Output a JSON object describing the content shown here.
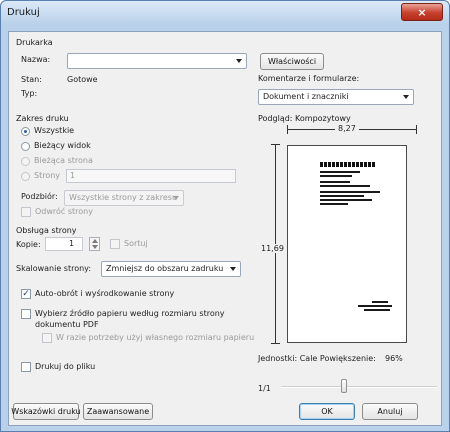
{
  "window": {
    "title": "Drukuj",
    "close_symbol": "×"
  },
  "printer": {
    "section_title": "Drukarka",
    "name_label": "Nazwa:",
    "name_value": "",
    "status_label": "Stan:",
    "status_value": "Gotowe",
    "type_label": "Typ:",
    "type_value": "",
    "properties_button": "Właściwości",
    "comments_label": "Komentarze i formularze:",
    "comments_value": "Dokument i znaczniki"
  },
  "print_range": {
    "section_title": "Zakres druku",
    "options": [
      {
        "label": "Wszystkie",
        "checked": true,
        "disabled": false
      },
      {
        "label": "Bieżący widok",
        "checked": false,
        "disabled": false
      },
      {
        "label": "Bieżąca strona",
        "checked": false,
        "disabled": true
      },
      {
        "label": "Strony",
        "checked": false,
        "disabled": true
      }
    ],
    "pages_value": "1",
    "subset_label": "Podzbiór:",
    "subset_value": "Wszystkie strony z zakresu",
    "reverse_label": "Odwróć strony"
  },
  "page_handling": {
    "section_title": "Obsługa strony",
    "copies_label": "Kopie:",
    "copies_value": "1",
    "collate_label": "Sortuj",
    "scaling_label": "Skalowanie strony:",
    "scaling_value": "Zmniejsz do obszaru zadruku",
    "auto_rotate_label": "Auto-obrót i wyśrodkowanie strony",
    "auto_rotate_checked": true,
    "paper_source_label": "Wybierz źródło papieru według rozmiaru strony dokumentu PDF",
    "custom_paper_label": "W razie potrzeby użyj własnego rozmiaru papieru",
    "print_to_file_label": "Drukuj do pliku"
  },
  "preview": {
    "title": "Podgląd: Kompozytowy",
    "width_value": "8,27",
    "height_value": "11,69",
    "units_label": "Jednostki: Cale Powiększenie:",
    "zoom_value": "96%",
    "page_counter": "1/1",
    "page_position": 0.45
  },
  "footer": {
    "tips_button": "Wskazówki druku",
    "advanced_button": "Zaawansowane",
    "ok_button": "OK",
    "cancel_button": "Anuluj"
  },
  "colors": {
    "frame": "#b9d1ea",
    "client_bg": "#f0f0f0",
    "close_red": "#c7412f"
  }
}
